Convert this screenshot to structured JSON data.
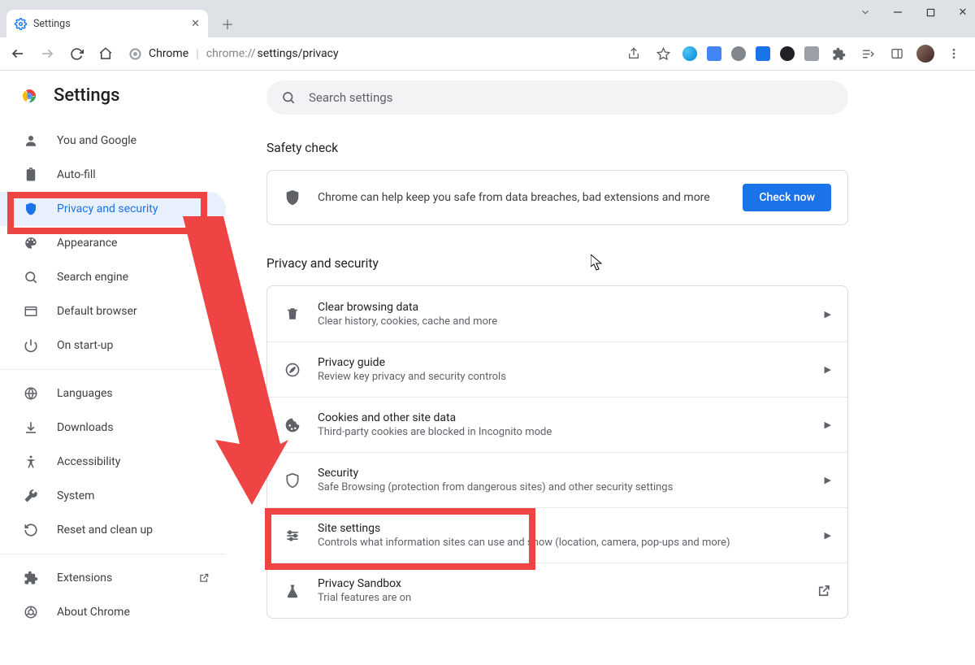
{
  "window": {
    "tab_title": "Settings",
    "new_tab_tooltip": "New tab"
  },
  "omnibox": {
    "scheme_label": "Chrome",
    "path_prefix": "chrome://",
    "path_bold": "settings/privacy"
  },
  "sidebar": {
    "title": "Settings",
    "items": [
      {
        "label": "You and Google"
      },
      {
        "label": "Auto-fill"
      },
      {
        "label": "Privacy and security"
      },
      {
        "label": "Appearance"
      },
      {
        "label": "Search engine"
      },
      {
        "label": "Default browser"
      },
      {
        "label": "On start-up"
      }
    ],
    "advanced": [
      {
        "label": "Languages"
      },
      {
        "label": "Downloads"
      },
      {
        "label": "Accessibility"
      },
      {
        "label": "System"
      },
      {
        "label": "Reset and clean up"
      }
    ],
    "footer": [
      {
        "label": "Extensions"
      },
      {
        "label": "About Chrome"
      }
    ]
  },
  "search": {
    "placeholder": "Search settings"
  },
  "safety": {
    "heading": "Safety check",
    "text": "Chrome can help keep you safe from data breaches, bad extensions and more",
    "button": "Check now"
  },
  "privacy": {
    "heading": "Privacy and security",
    "rows": [
      {
        "title": "Clear browsing data",
        "sub": "Clear history, cookies, cache and more"
      },
      {
        "title": "Privacy guide",
        "sub": "Review key privacy and security controls"
      },
      {
        "title": "Cookies and other site data",
        "sub": "Third-party cookies are blocked in Incognito mode"
      },
      {
        "title": "Security",
        "sub": "Safe Browsing (protection from dangerous sites) and other security settings"
      },
      {
        "title": "Site settings",
        "sub": "Controls what information sites can use and show (location, camera, pop-ups and more)"
      },
      {
        "title": "Privacy Sandbox",
        "sub": "Trial features are on"
      }
    ]
  },
  "colors": {
    "annotation": "#ef4444",
    "accent": "#1a73e8"
  }
}
